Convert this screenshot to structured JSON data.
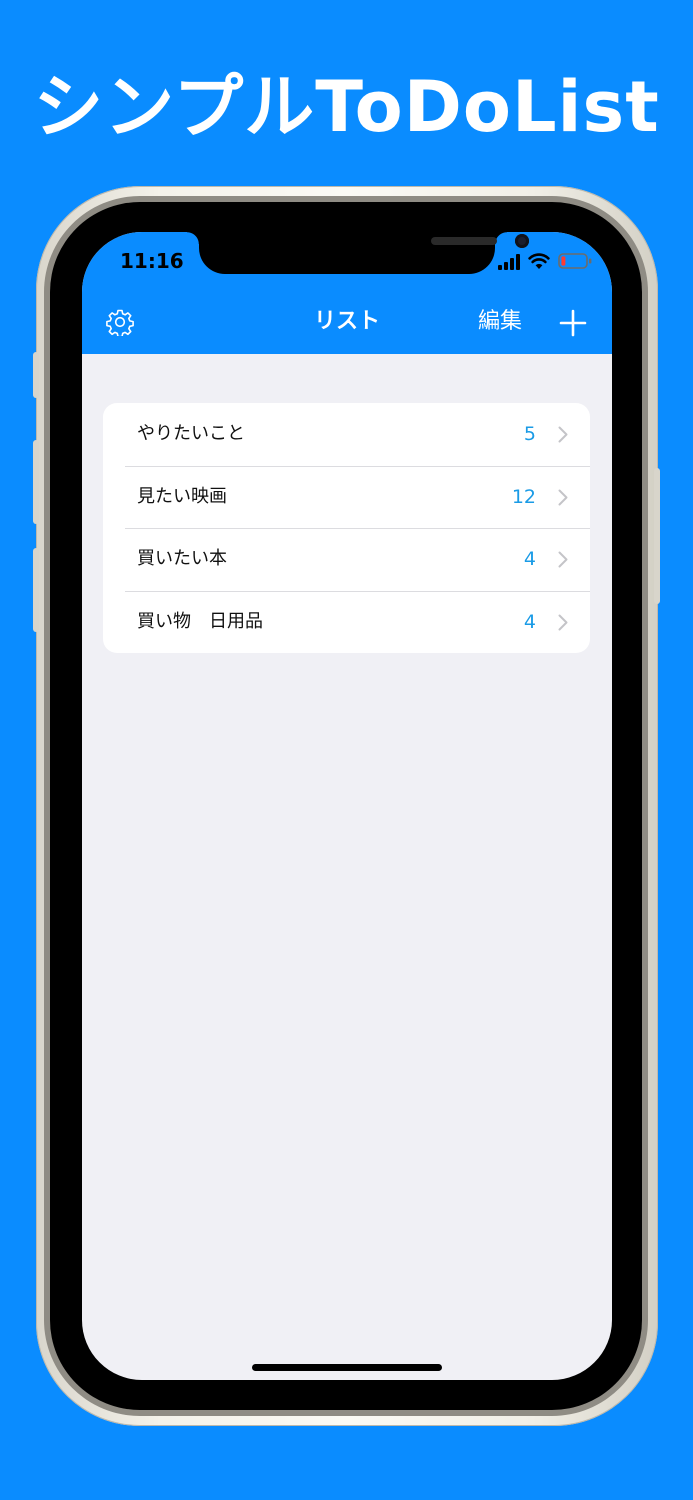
{
  "promo": {
    "title": "シンプルToDoList"
  },
  "status_bar": {
    "time": "11:16",
    "battery_color": "#ff3b30"
  },
  "nav": {
    "title": "リスト",
    "edit_label": "編集",
    "settings_icon": "gear-icon",
    "add_icon": "plus-icon",
    "bar_color": "#0a8cff"
  },
  "lists": [
    {
      "label": "やりたいこと",
      "count": "5"
    },
    {
      "label": "見たい映画",
      "count": "12"
    },
    {
      "label": "買いたい本",
      "count": "4"
    },
    {
      "label": "買い物　日用品",
      "count": "4"
    }
  ],
  "colors": {
    "background": "#0a8cff",
    "screen_bg": "#f0f0f5",
    "count_text": "#1a9be6",
    "chevron": "#c4c4c8"
  }
}
